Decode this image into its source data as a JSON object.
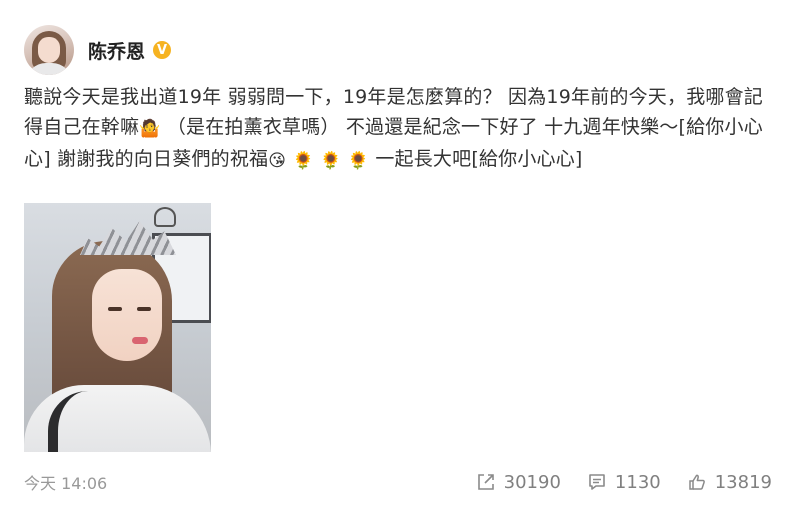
{
  "post": {
    "username": "陈乔恩",
    "verified_badge": "V",
    "verified_color": "#f6b321",
    "text": {
      "p1": "聽說今天是我出道19年 弱弱問一下，19年是怎麼算的？ 因為19年前的今天，我哪會記得自己在幹嘛",
      "p2": " （是在拍薰衣草嗎） 不過還是紀念一下好了 十九週年快樂～[給你小心心] 謝謝我的向日葵們的祝福",
      "p3": " 一起長大吧[給你小心心]"
    },
    "emojis": {
      "shrug": "🤷",
      "kiss": "😘",
      "sunflower": "🌻"
    }
  },
  "footer": {
    "timestamp": "今天 14:06",
    "repost_count": "30190",
    "comment_count": "1130",
    "like_count": "13819",
    "icon_color": "#808080"
  }
}
